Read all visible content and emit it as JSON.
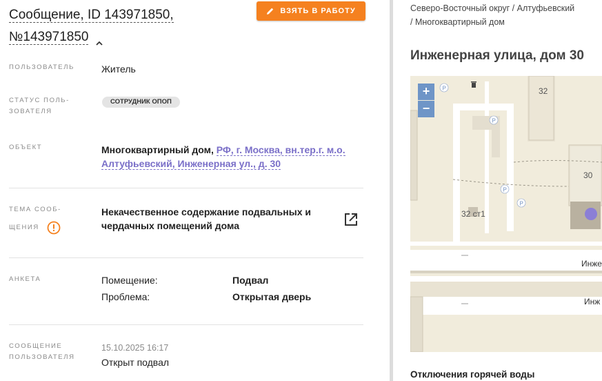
{
  "header": {
    "title_line1": "Сообщение, ID 143971850,",
    "title_line2": "№143971850",
    "take_button": "ВЗЯТЬ В РАБОТУ"
  },
  "fields": {
    "user_label": "ПОЛЬЗОВАТЕЛЬ",
    "user_value": "Житель",
    "status_label_1": "СТАТУС ПОЛЬ-",
    "status_label_2": "ЗОВАТЕЛЯ",
    "status_badge": "СОТРУДНИК ОПОП",
    "object_label": "ОБЪЕКТ",
    "object_prefix": "Многоквартирный дом,",
    "object_link_1": "РФ, г. Москва, вн.тер.г. м.о.",
    "object_link_2": "Алтуфьевский, Инженерная ул., д. 30",
    "topic_label_1": "ТЕМА СООБ-",
    "topic_label_2": "ЩЕНИЯ",
    "topic_value_1": "Некачественное содержание подвальных и",
    "topic_value_2": "чердачных помещений дома",
    "survey_label": "АНКЕТА",
    "survey": [
      {
        "key": "Помещение:",
        "value": "Подвал"
      },
      {
        "key": "Проблема:",
        "value": "Открытая дверь"
      }
    ],
    "message_label_1": "СООБЩЕНИЕ",
    "message_label_2": "ПОЛЬЗОВАТЕЛЯ",
    "message_time": "15.10.2025 16:17",
    "message_text": "Открыт подвал"
  },
  "location": {
    "breadcrumb_1": "Северо-Восточный округ / Алтуфьевский",
    "breadcrumb_2": "/ Многоквартирный дом",
    "address_title": "Инженерная улица, дом 30",
    "map": {
      "zoom_in": "+",
      "zoom_out": "−",
      "parking": "P",
      "building_32": "32",
      "building_30": "30",
      "building_32s1": "32 ст1",
      "street_1": "Инже",
      "street_2": "Инж"
    },
    "outage_title": "Отключения горячей воды"
  },
  "colors": {
    "accent_orange": "#f5811f",
    "link_purple": "#7a6fc8",
    "map_bg": "#f1ecdc",
    "map_marker": "#8b7fd6"
  }
}
